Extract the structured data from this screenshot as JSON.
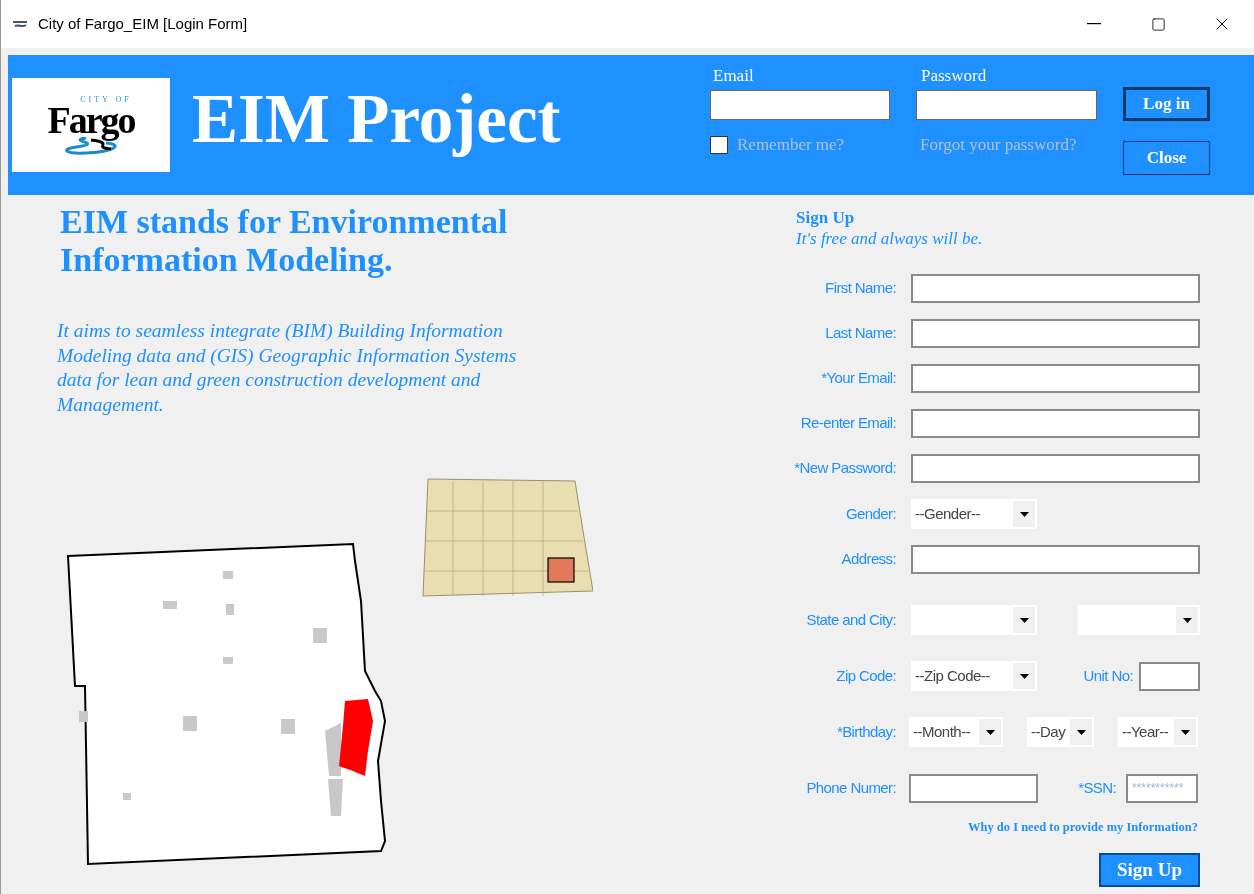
{
  "window": {
    "title": "City of Fargo_EIM [Login Form]"
  },
  "header": {
    "logo": {
      "top": "CITY OF",
      "name": "Fargo"
    },
    "title": "EIM Project"
  },
  "login": {
    "email_label": "Email",
    "password_label": "Password",
    "remember": {
      "label": "Remember me?",
      "checked": false
    },
    "forgot_link": "Forgot your password?",
    "buttons": [
      {
        "label": "Log in",
        "default": true
      },
      {
        "label": "Close",
        "default": false
      }
    ]
  },
  "intro": {
    "heading": "EIM stands for Environmental Information Modeling.",
    "body": "It aims to seamless integrate (BIM) Building Information Modeling data and (GIS) Geographic Information Systems data for lean and green construction development and Management."
  },
  "signup": {
    "title": "Sign Up",
    "subtitle": "It's free and always will be.",
    "rows": [
      {
        "kind": "text",
        "label": "First Name:"
      },
      {
        "kind": "text",
        "label": "Last Name:"
      },
      {
        "kind": "text",
        "label": "*Your Email:"
      },
      {
        "kind": "text",
        "label": "Re-enter Email:"
      },
      {
        "kind": "text",
        "label": "*New Password:"
      },
      {
        "kind": "select",
        "label": "Gender:",
        "value": "--Gender--"
      },
      {
        "kind": "text",
        "label": "Address:"
      },
      {
        "kind": "pair",
        "label": "State and City:"
      },
      {
        "kind": "zip",
        "label": "Zip Code:",
        "value": "--Zip Code--",
        "side_label": "Unit No:"
      },
      {
        "kind": "birthday",
        "label": "*Birthday:",
        "values": [
          "--Month--",
          "--Day",
          "--Year--"
        ]
      },
      {
        "kind": "phone",
        "label": "Phone Numer:",
        "side_label": "*SSN:",
        "placeholder": "***********"
      }
    ],
    "info_link": "Why do I need to provide my Information?",
    "button": "Sign Up"
  }
}
